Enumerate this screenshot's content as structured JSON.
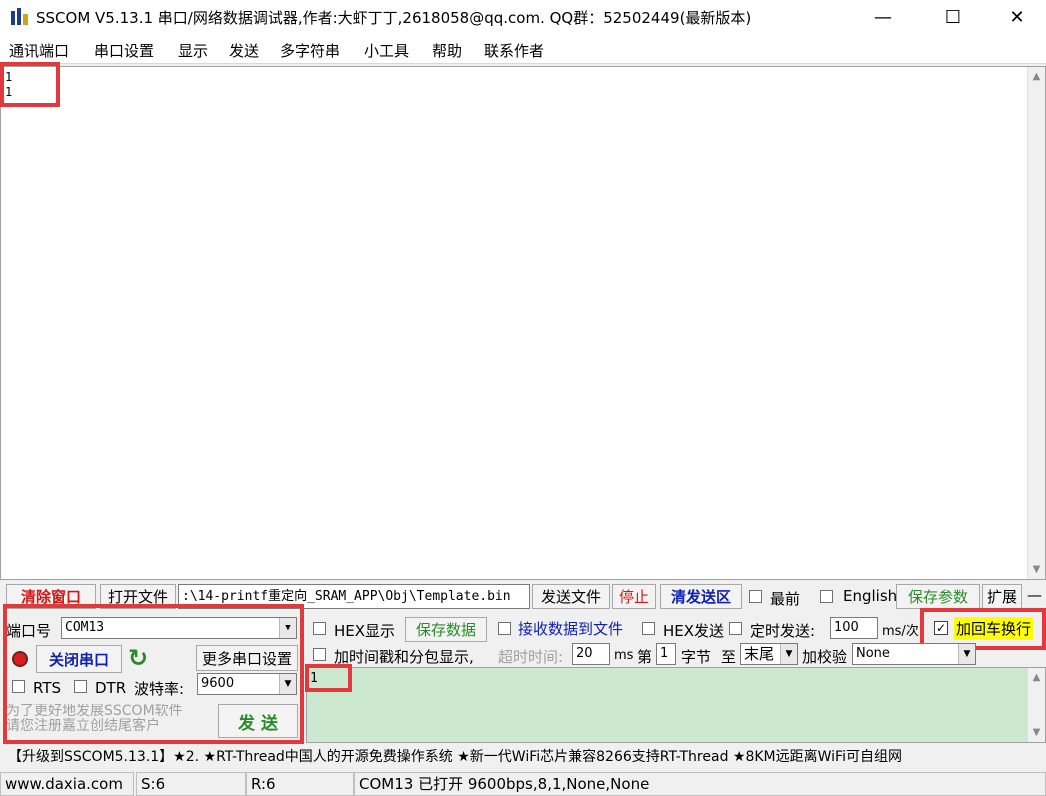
{
  "window": {
    "title": "SSCOM V5.13.1 串口/网络数据调试器,作者:大虾丁丁,2618058@qq.com. QQ群：52502449(最新版本)",
    "minimize": "—",
    "maximize": "☐",
    "close": "✕"
  },
  "menu": [
    "通讯端口",
    "串口设置",
    "显示",
    "发送",
    "多字符串",
    "小工具",
    "帮助",
    "联系作者"
  ],
  "receive": {
    "text": "1\n1"
  },
  "toolbar": {
    "clear": "清除窗口",
    "open_file": "打开文件",
    "file_path": ":\\14-printf重定向_SRAM_APP\\Obj\\Template.bin",
    "send_file": "发送文件",
    "stop": "停止",
    "clear_send": "清发送区",
    "topmost": "最前",
    "english": "English",
    "save_params": "保存参数",
    "expand": "扩展",
    "dash": "—"
  },
  "port": {
    "port_label": "端口号",
    "port_value": "COM13",
    "close_port": "关闭串口",
    "more_settings": "更多串口设置",
    "rts": "RTS",
    "dtr": "DTR",
    "baud_label": "波特率:",
    "baud_value": "9600",
    "promo": "为了更好地发展SSCOM软件\n请您注册嘉立创结尾客户",
    "send": "发 送"
  },
  "options": {
    "hex_display": "HEX显示",
    "save_data": "保存数据",
    "recv_to_file": "接收数据到文件",
    "hex_send": "HEX发送",
    "timed_send": "定时发送:",
    "interval": "100",
    "interval_unit": "ms/次",
    "add_crlf": "加回车换行",
    "add_timestamp": "加时间戳和分包显示,",
    "timeout_label": "超时时间:",
    "timeout_value": "20",
    "ms": "ms",
    "nth": "第",
    "byte_index": "1",
    "byte_label": "字节",
    "to": "至",
    "end_value": "末尾",
    "checksum_label": "加校验",
    "checksum_value": "None"
  },
  "send_area": {
    "text": "1"
  },
  "ticker": "【升级到SSCOM5.13.1】★2. ★RT-Thread中国人的开源免费操作系统 ★新一代WiFi芯片兼容8266支持RT-Thread ★8KM远距离WiFi可自组网",
  "status": {
    "website": "www.daxia.com",
    "sent": "S:6",
    "received": "R:6",
    "port_status": "COM13 已打开  9600bps,8,1,None,None"
  },
  "colors": {
    "highlight": "#e0393e",
    "send_bg": "#cce8cf",
    "green_text": "#2a8a2a",
    "red_text": "#d01818",
    "crlf_bg": "#ffff00"
  }
}
